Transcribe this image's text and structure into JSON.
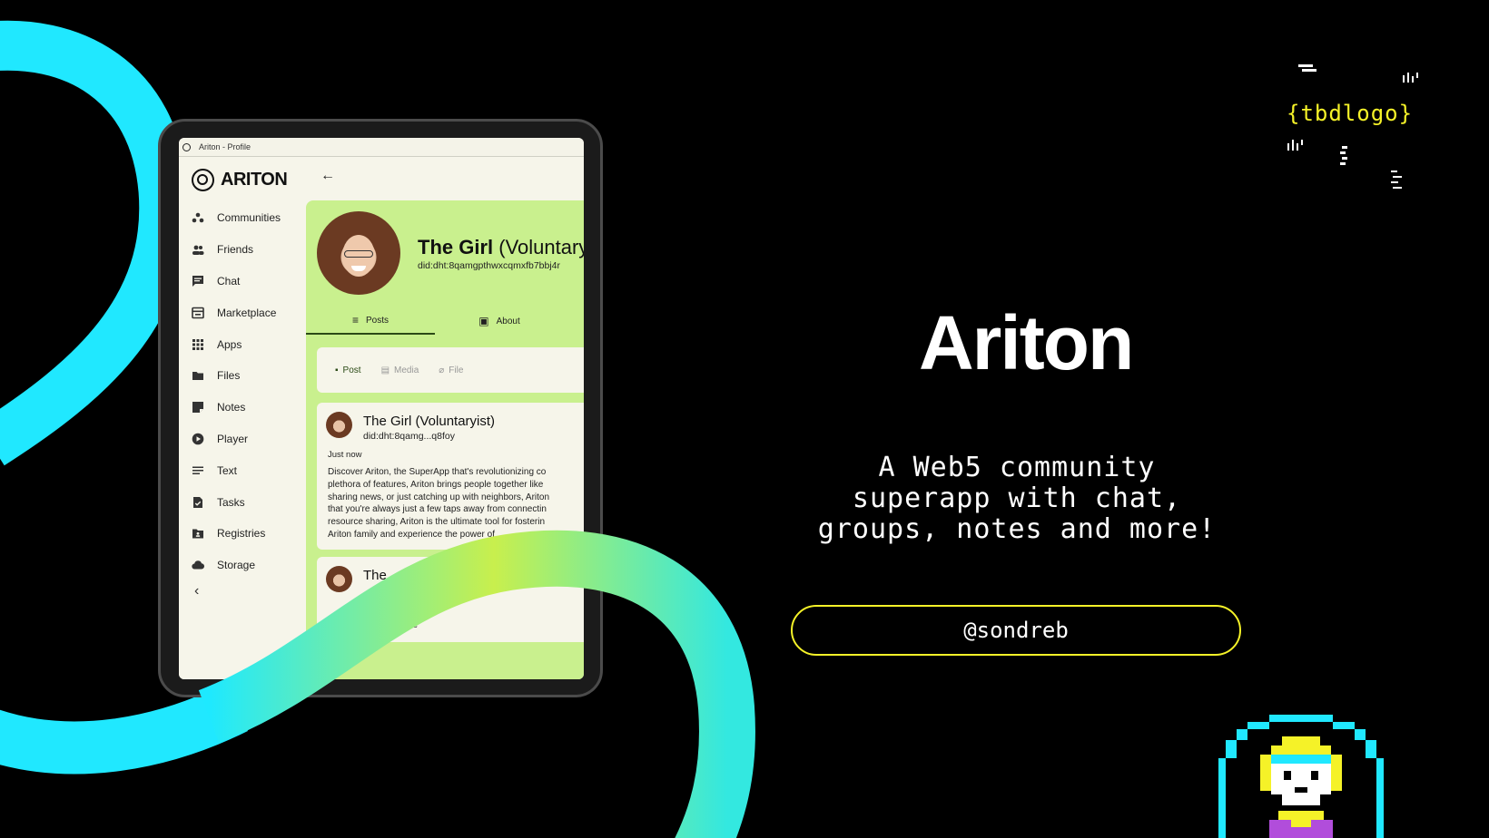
{
  "window": {
    "title": "Ariton - Profile"
  },
  "app": {
    "brand": "ARITON"
  },
  "sidebar": {
    "items": [
      {
        "label": "Communities",
        "icon": "communities-icon"
      },
      {
        "label": "Friends",
        "icon": "friends-icon"
      },
      {
        "label": "Chat",
        "icon": "chat-icon"
      },
      {
        "label": "Marketplace",
        "icon": "marketplace-icon"
      },
      {
        "label": "Apps",
        "icon": "apps-icon"
      },
      {
        "label": "Files",
        "icon": "folder-icon"
      },
      {
        "label": "Notes",
        "icon": "notes-icon"
      },
      {
        "label": "Player",
        "icon": "play-icon"
      },
      {
        "label": "Text",
        "icon": "text-icon"
      },
      {
        "label": "Tasks",
        "icon": "tasks-icon"
      },
      {
        "label": "Registries",
        "icon": "registries-icon"
      },
      {
        "label": "Storage",
        "icon": "cloud-icon"
      }
    ]
  },
  "profile": {
    "name_bold": "The Girl",
    "name_suffix": " (Voluntaryist)",
    "did": "did:dht:8qamgpthwxcqmxfb7bbj4r"
  },
  "tabs": [
    {
      "label": "Posts",
      "active": true
    },
    {
      "label": "About",
      "active": false
    }
  ],
  "composer": {
    "post": "Post",
    "media": "Media",
    "file": "File"
  },
  "posts": [
    {
      "author": "The Girl (Voluntaryist)",
      "did": "did:dht:8qamg...q8foy",
      "time": "Just now",
      "lines": [
        "Discover Ariton, the SuperApp that's revolutionizing co",
        "plethora of features, Ariton brings people together like",
        "sharing news, or just catching up with neighbors, Ariton",
        "that you're always just a few taps away from connectin",
        "resource sharing, Ariton is the ultimate tool for fosterin",
        "Ariton family and experience the power of"
      ]
    },
    {
      "author": "The",
      "text": "m here"
    }
  ],
  "promo": {
    "headline": "Ariton",
    "tagline": [
      "A Web5 community",
      "superapp with chat,",
      "groups, notes and more!"
    ],
    "handle": "@sondreb",
    "tbd_logo": "{tbdlogo}"
  },
  "colors": {
    "cyan": "#20e8ff",
    "lime": "#c9f08e",
    "yellow": "#f5f228"
  }
}
